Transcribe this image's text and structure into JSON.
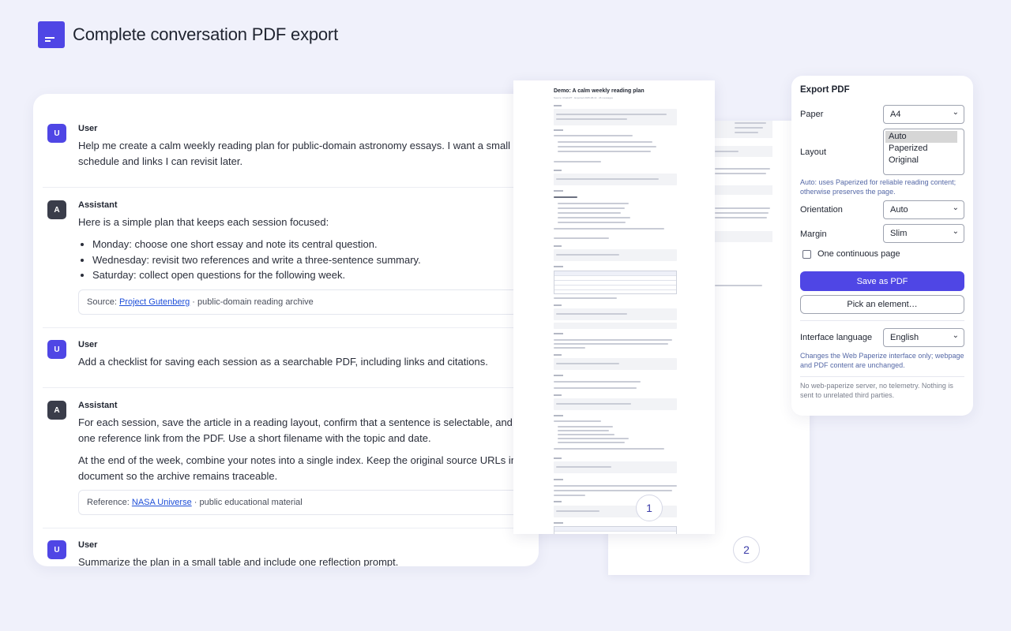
{
  "header": {
    "title": "Complete conversation PDF export",
    "logo_icon": "document-icon"
  },
  "chat": {
    "messages": [
      {
        "avatar": "U",
        "role": "User",
        "text": "Help me create a calm weekly reading plan for public-domain astronomy essays. I want a small",
        "text2": "schedule and links I can revisit later."
      },
      {
        "avatar": "A",
        "role": "Assistant",
        "text": "Here is a simple plan that keeps each session focused:",
        "bullets": [
          "Monday: choose one short essay and note its central question.",
          "Wednesday: revisit two references and write a three-sentence summary.",
          "Saturday: collect open questions for the following week."
        ],
        "source_prefix": "Source: ",
        "source_link": "Project Gutenberg",
        "source_suffix": " · public-domain reading archive"
      },
      {
        "avatar": "U",
        "role": "User",
        "text": "Add a checklist for saving each session as a searchable PDF, including links and citations."
      },
      {
        "avatar": "A",
        "role": "Assistant",
        "text": "For each session, save the article in a reading layout, confirm that a sentence is selectable, and open",
        "text2": "one reference link from the PDF. Use a short filename with the topic and date.",
        "para2": "At the end of the week, combine your notes into a single index. Keep the original source URLs in the",
        "para2b": "document so the archive remains traceable.",
        "source_prefix": "Reference: ",
        "source_link": "NASA Universe",
        "source_suffix": " · public educational material"
      },
      {
        "avatar": "U",
        "role": "User",
        "text": "Summarize the plan in a small table and include one reflection prompt."
      }
    ]
  },
  "preview": {
    "page1_title": "Demo: A calm weekly reading plan",
    "page1_sub": "Source: ChatGPT · Exported 2025-08-14 · 26 messages",
    "page1_number": "1",
    "page2_number": "2"
  },
  "panel": {
    "title": "Export PDF",
    "paper_label": "Paper",
    "paper_value": "A4",
    "layout_label": "Layout",
    "layout_options": [
      "Auto",
      "Paperized",
      "Original"
    ],
    "layout_selected": "Auto",
    "layout_hint": "Auto: uses Paperized for reliable reading content; otherwise preserves the page.",
    "orientation_label": "Orientation",
    "orientation_value": "Auto",
    "margin_label": "Margin",
    "margin_value": "Slim",
    "continuous_label": "One continuous page",
    "save_label": "Save as PDF",
    "pick_label": "Pick an element…",
    "language_label": "Interface language",
    "language_value": "English",
    "language_hint": "Changes the Web Paperize interface only; webpage and PDF content are unchanged.",
    "privacy_note": "No web-paperize server, no telemetry. Nothing is sent to unrelated third parties."
  }
}
